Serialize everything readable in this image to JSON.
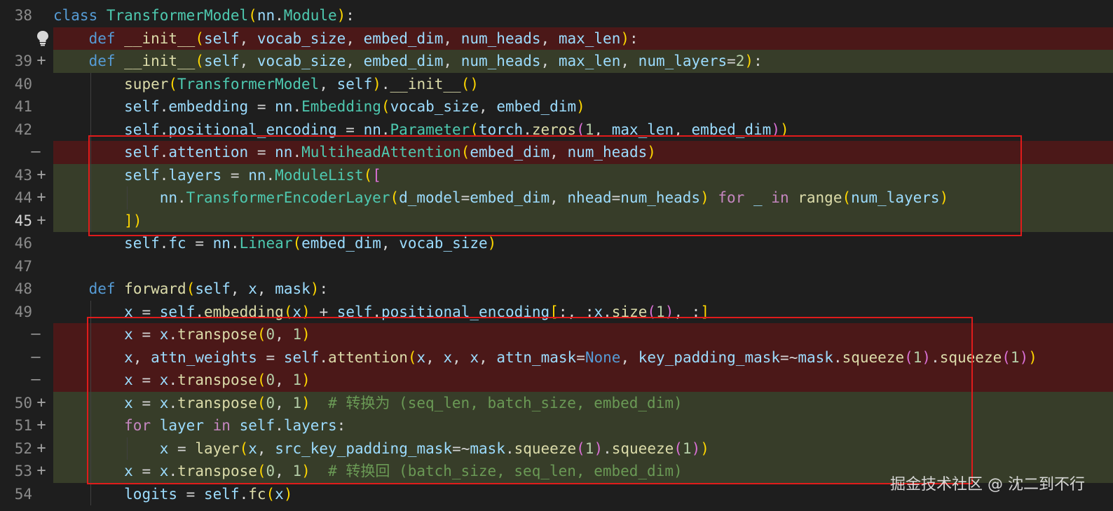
{
  "theme": {
    "background": "#1e1e1e",
    "deleted_line": "#4b1818",
    "added_line": "#373d29",
    "highlight_box": "#e01b1b"
  },
  "gutter_icon": "lightbulb-icon",
  "lines": [
    {
      "num": "38",
      "kind": "ctx",
      "marker": "",
      "code": "class TransformerModel(nn.Module):"
    },
    {
      "num": "",
      "kind": "del",
      "marker": "",
      "code": "    def __init__(self, vocab_size, embed_dim, num_heads, max_len):"
    },
    {
      "num": "39",
      "kind": "add",
      "marker": "+",
      "code": "    def __init__(self, vocab_size, embed_dim, num_heads, max_len, num_layers=2):"
    },
    {
      "num": "40",
      "kind": "ctx",
      "marker": "",
      "code": "        super(TransformerModel, self).__init__()"
    },
    {
      "num": "41",
      "kind": "ctx",
      "marker": "",
      "code": "        self.embedding = nn.Embedding(vocab_size, embed_dim)"
    },
    {
      "num": "42",
      "kind": "ctx",
      "marker": "",
      "code": "        self.positional_encoding = nn.Parameter(torch.zeros(1, max_len, embed_dim))"
    },
    {
      "num": "",
      "kind": "del",
      "marker": "—",
      "code": "        self.attention = nn.MultiheadAttention(embed_dim, num_heads)"
    },
    {
      "num": "43",
      "kind": "add",
      "marker": "+",
      "code": "        self.layers = nn.ModuleList(["
    },
    {
      "num": "44",
      "kind": "add",
      "marker": "+",
      "code": "            nn.TransformerEncoderLayer(d_model=embed_dim, nhead=num_heads) for _ in range(num_layers)"
    },
    {
      "num": "45",
      "kind": "add",
      "marker": "+",
      "code": "        ])",
      "active": true
    },
    {
      "num": "46",
      "kind": "ctx",
      "marker": "",
      "code": "        self.fc = nn.Linear(embed_dim, vocab_size)"
    },
    {
      "num": "47",
      "kind": "ctx",
      "marker": "",
      "code": ""
    },
    {
      "num": "48",
      "kind": "ctx",
      "marker": "",
      "code": "    def forward(self, x, mask):"
    },
    {
      "num": "49",
      "kind": "ctx",
      "marker": "",
      "code": "        x = self.embedding(x) + self.positional_encoding[:, :x.size(1), :]"
    },
    {
      "num": "",
      "kind": "del",
      "marker": "—",
      "code": "        x = x.transpose(0, 1)"
    },
    {
      "num": "",
      "kind": "del",
      "marker": "—",
      "code": "        x, attn_weights = self.attention(x, x, x, attn_mask=None, key_padding_mask=~mask.squeeze(1).squeeze(1))"
    },
    {
      "num": "",
      "kind": "del",
      "marker": "—",
      "code": "        x = x.transpose(0, 1)"
    },
    {
      "num": "50",
      "kind": "add",
      "marker": "+",
      "code": "        x = x.transpose(0, 1)  # 转换为 (seq_len, batch_size, embed_dim)"
    },
    {
      "num": "51",
      "kind": "add",
      "marker": "+",
      "code": "        for layer in self.layers:"
    },
    {
      "num": "52",
      "kind": "add",
      "marker": "+",
      "code": "            x = layer(x, src_key_padding_mask=~mask.squeeze(1).squeeze(1))"
    },
    {
      "num": "53",
      "kind": "add",
      "marker": "+",
      "code": "        x = x.transpose(0, 1)  # 转换回 (batch_size, seq_len, embed_dim)"
    },
    {
      "num": "54",
      "kind": "ctx",
      "marker": "",
      "code": "        logits = self.fc(x)"
    }
  ],
  "watermark": "掘金技术社区 @ 沈二到不行"
}
